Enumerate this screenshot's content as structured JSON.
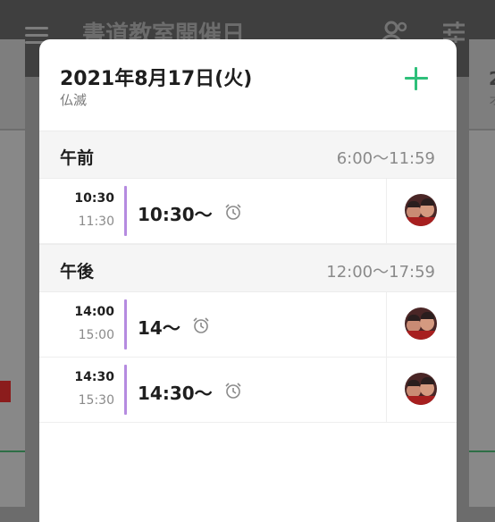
{
  "background_app": {
    "title": "書道教室開催日",
    "fragment_right_top": "2",
    "fragment_right_sub": "オ"
  },
  "dialog": {
    "date": "2021年8月17日(火)",
    "rokuyo": "仏滅",
    "accent_color": "#2ec07a",
    "event_bar_color": "#b58be0",
    "sections": [
      {
        "label": "午前",
        "range": "6:00〜11:59",
        "events": [
          {
            "start": "10:30",
            "end": "11:30",
            "title": "10:30〜"
          }
        ]
      },
      {
        "label": "午後",
        "range": "12:00〜17:59",
        "events": [
          {
            "start": "14:00",
            "end": "15:00",
            "title": "14〜"
          },
          {
            "start": "14:30",
            "end": "15:30",
            "title": "14:30〜"
          }
        ]
      }
    ]
  }
}
